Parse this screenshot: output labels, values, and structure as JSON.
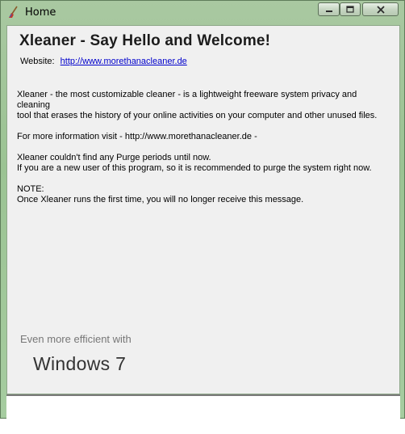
{
  "window": {
    "title": "Home",
    "icon": "broom-app-icon",
    "controls": {
      "minimize": "minimize-icon",
      "maximize": "maximize-icon",
      "close": "close-icon"
    }
  },
  "content": {
    "heading": "Xleaner - Say Hello and Welcome!",
    "website_label": "Website:",
    "website_link": "http://www.morethanacleaner.de",
    "paragraphs": [
      [
        "Xleaner - the most customizable cleaner - is a lightweight freeware system privacy and cleaning",
        "tool that erases the history of your online activities on your computer and other unused files."
      ],
      [
        "For more information visit - http://www.morethanacleaner.de -"
      ],
      [
        "Xleaner couldn't find any Purge periods until now.",
        "If you are a new user of this program, so it is recommended to purge the system right now."
      ],
      [
        "NOTE:",
        "Once Xleaner runs the first time, you will no longer receive this message."
      ]
    ]
  },
  "promo": {
    "subtitle": "Even more efficient with",
    "title": "Windows 7"
  },
  "colors": {
    "frame": "#9bc393",
    "client_bg": "#f0f0f0",
    "link": "#0000cc"
  }
}
